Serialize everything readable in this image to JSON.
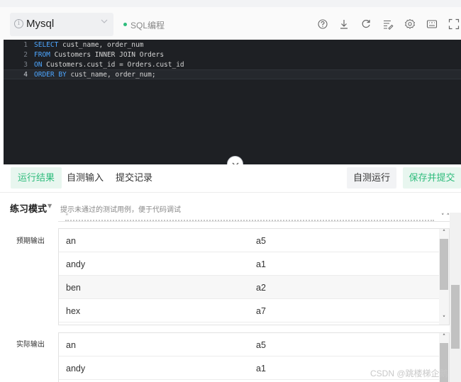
{
  "toolbar": {
    "language": "Mysql",
    "mode": "SQL编程",
    "info_icon": "info-circle-icon",
    "dropdown_icon": "chevron-down-icon",
    "tools": [
      "help-icon",
      "download-icon",
      "reset-icon",
      "format-icon",
      "settings-icon",
      "shortcut-icon",
      "fullscreen-icon"
    ]
  },
  "editor": {
    "lines": [
      {
        "num": "1",
        "kw1": "SELECT",
        "rest1": " cust_name, order_num",
        "kw2": "",
        "rest2": ""
      },
      {
        "num": "2",
        "kw1": "FROM",
        "rest1": " Customers INNER JOIN Orders",
        "kw2": "",
        "rest2": ""
      },
      {
        "num": "3",
        "kw1": "ON",
        "rest1": " Customers.cust_id = Orders.cust_id",
        "kw2": "",
        "rest2": ""
      },
      {
        "num": "4",
        "kw1": "ORDER BY",
        "rest1": " cust_name, order_num;",
        "kw2": "",
        "rest2": ""
      }
    ],
    "active_line": 4
  },
  "tabs": {
    "items": [
      "运行结果",
      "自测输入",
      "提交记录"
    ],
    "active": "运行结果",
    "run_button": "自测运行",
    "submit_button": "保存并提交"
  },
  "practice": {
    "title": "练习模式",
    "hint": "提示未通过的测试用例，便于代码调试"
  },
  "expected": {
    "label": "预期输出",
    "rows": [
      [
        "an",
        "a5"
      ],
      [
        "andy",
        "a1"
      ],
      [
        "ben",
        "a2"
      ],
      [
        "hex",
        "a7"
      ]
    ]
  },
  "actual": {
    "label": "实际输出",
    "rows": [
      [
        "an",
        "a5"
      ],
      [
        "andy",
        "a1"
      ]
    ]
  },
  "watermark": "CSDN @跳楼梯企鹅",
  "colors": {
    "accent": "#2ebc7c",
    "keyword": "#4da6ff",
    "editor_bg": "#1e2024"
  }
}
